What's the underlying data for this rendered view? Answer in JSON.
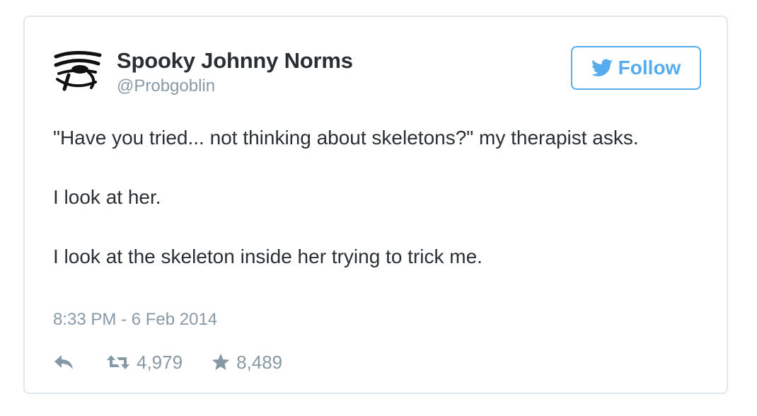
{
  "tweet": {
    "author": {
      "name": "Spooky Johnny Norms",
      "handle": "@Probgoblin",
      "avatar_icon": "eye-of-horus-icon"
    },
    "follow_button": {
      "label": "Follow",
      "icon": "twitter-bird-icon"
    },
    "text": {
      "paragraph_1": "\"Have you tried... not thinking about skeletons?\" my therapist asks.",
      "paragraph_2": "I look at her.",
      "paragraph_3": "I look at the skeleton inside her trying to trick me."
    },
    "timestamp": "8:33 PM - 6 Feb 2014",
    "actions": {
      "reply_icon": "reply-icon",
      "retweet_icon": "retweet-icon",
      "retweet_count": "4,979",
      "favorite_icon": "star-icon",
      "favorite_count": "8,489"
    }
  },
  "colors": {
    "twitter_blue": "#55acee",
    "text": "#292f33",
    "secondary_text": "#8899a6",
    "border": "#e1e8ed"
  }
}
